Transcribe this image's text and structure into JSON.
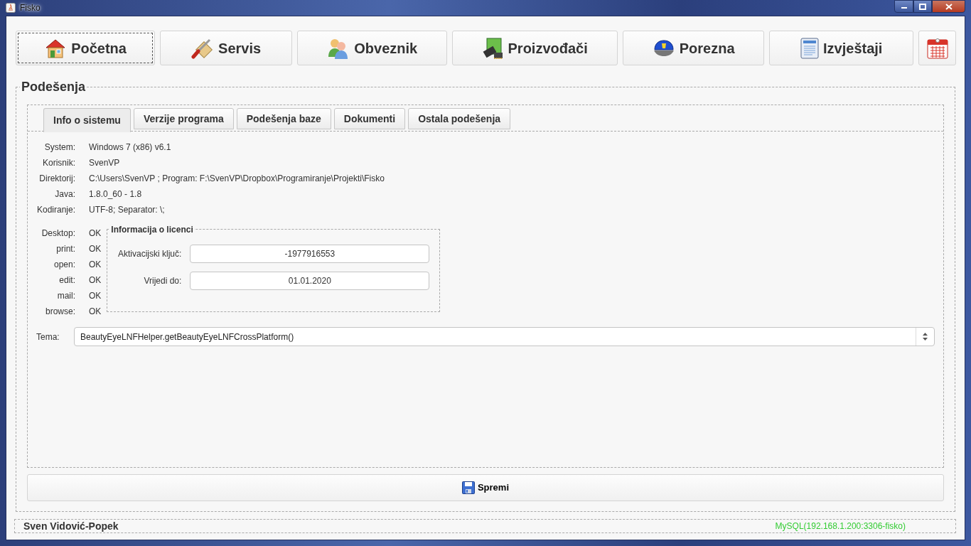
{
  "window": {
    "title": "Fisko"
  },
  "nav_buttons": [
    {
      "label": "Početna",
      "focused": true
    },
    {
      "label": "Servis",
      "focused": false
    },
    {
      "label": "Obveznik",
      "focused": false
    },
    {
      "label": "Proizvođači",
      "focused": false
    },
    {
      "label": "Porezna",
      "focused": false
    },
    {
      "label": "Izvještaji",
      "focused": false
    },
    {
      "focused": false
    }
  ],
  "section_title": "Podešenja",
  "tabs": [
    {
      "label": "Info o sistemu",
      "selected": true
    },
    {
      "label": "Verzije programa",
      "selected": false
    },
    {
      "label": "Podešenja baze",
      "selected": false
    },
    {
      "label": "Dokumenti",
      "selected": false
    },
    {
      "label": "Ostala podešenja",
      "selected": false
    }
  ],
  "info_rows": [
    {
      "label": "System:",
      "value": "Windows 7 (x86) v6.1"
    },
    {
      "label": "Korisnik:",
      "value": "SvenVP"
    },
    {
      "label": "Direktorij:",
      "value": "C:\\Users\\SvenVP ; Program: F:\\SvenVP\\Dropbox\\Programiranje\\Projekti\\Fisko"
    },
    {
      "label": "Java:",
      "value": "1.8.0_60 - 1.8"
    },
    {
      "label": "Kodiranje:",
      "value": "UTF-8; Separator: \\;"
    }
  ],
  "desktop_rows": [
    {
      "label": "Desktop:",
      "value": "OK"
    },
    {
      "label": "print:",
      "value": "OK"
    },
    {
      "label": "open:",
      "value": "OK"
    },
    {
      "label": "edit:",
      "value": "OK"
    },
    {
      "label": "mail:",
      "value": "OK"
    },
    {
      "label": "browse:",
      "value": "OK"
    }
  ],
  "license": {
    "title": "Informacija o licenci",
    "fields": [
      {
        "label": "Aktivacijski ključ:",
        "value": "-1977916553"
      },
      {
        "label": "Vrijedi do:",
        "value": "01.01.2020"
      }
    ]
  },
  "theme": {
    "label": "Tema:",
    "value": "BeautyEyeLNFHelper.getBeautyEyeLNFCrossPlatform()"
  },
  "save_button": "Spremi",
  "status_bar": {
    "user": "Sven Vidović-Popek",
    "connection": "MySQL(192.168.1.200:3306-fisko)"
  }
}
